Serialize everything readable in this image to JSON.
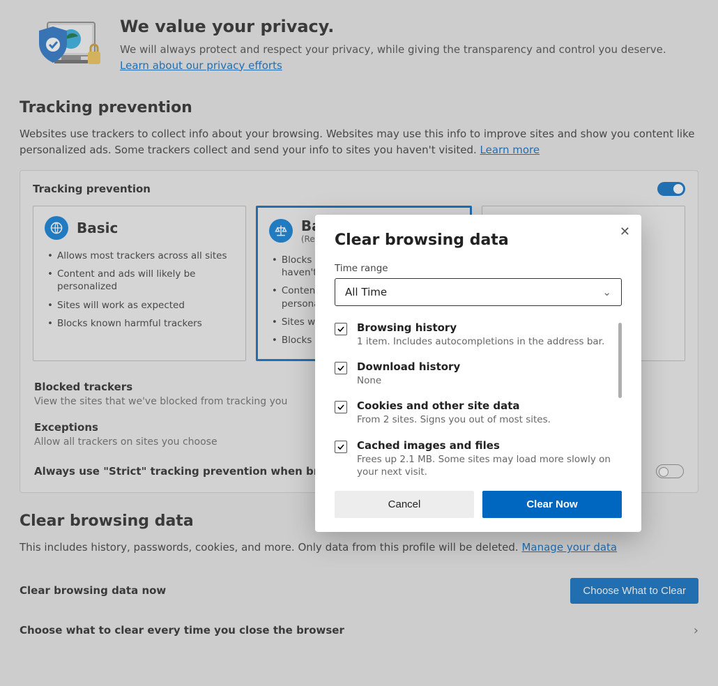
{
  "header": {
    "title": "We value your privacy.",
    "body": "We will always protect and respect your privacy, while giving the transparency and control you deserve. ",
    "link": "Learn about our privacy efforts"
  },
  "tracking": {
    "heading": "Tracking prevention",
    "desc": "Websites use trackers to collect info about your browsing. Websites may use this info to improve sites and show you content like personalized ads. Some trackers collect and send your info to sites you haven't visited. ",
    "learn_more": "Learn more",
    "card_title": "Tracking prevention",
    "levels": [
      {
        "title": "Basic",
        "sub": "",
        "items": [
          "Allows most trackers across all sites",
          "Content and ads will likely be personalized",
          "Sites will work as expected",
          "Blocks known harmful trackers"
        ]
      },
      {
        "title": "Balanced",
        "sub": "(Recommended)",
        "items": [
          "Blocks trackers from sites you haven't visited",
          "Content and ads will likely be less personalized",
          "Sites will work as expected",
          "Blocks known harmful trackers"
        ]
      }
    ],
    "blocked_title": "Blocked trackers",
    "blocked_desc": "View the sites that we've blocked from tracking you",
    "exceptions_title": "Exceptions",
    "exceptions_desc": "Allow all trackers on sites you choose",
    "strict_row": "Always use \"Strict\" tracking prevention when browsing InPrivate"
  },
  "clear": {
    "heading": "Clear browsing data",
    "desc": "This includes history, passwords, cookies, and more. Only data from this profile will be deleted. ",
    "manage_link": "Manage your data",
    "now_title": "Clear browsing data now",
    "choose_btn": "Choose What to Clear",
    "close_row": "Choose what to clear every time you close the browser"
  },
  "modal": {
    "title": "Clear browsing data",
    "range_label": "Time range",
    "range_value": "All Time",
    "items": [
      {
        "title": "Browsing history",
        "desc": "1 item. Includes autocompletions in the address bar."
      },
      {
        "title": "Download history",
        "desc": "None"
      },
      {
        "title": "Cookies and other site data",
        "desc": "From 2 sites. Signs you out of most sites."
      },
      {
        "title": "Cached images and files",
        "desc": "Frees up 2.1 MB. Some sites may load more slowly on your next visit."
      }
    ],
    "cancel": "Cancel",
    "clear_now": "Clear Now"
  }
}
